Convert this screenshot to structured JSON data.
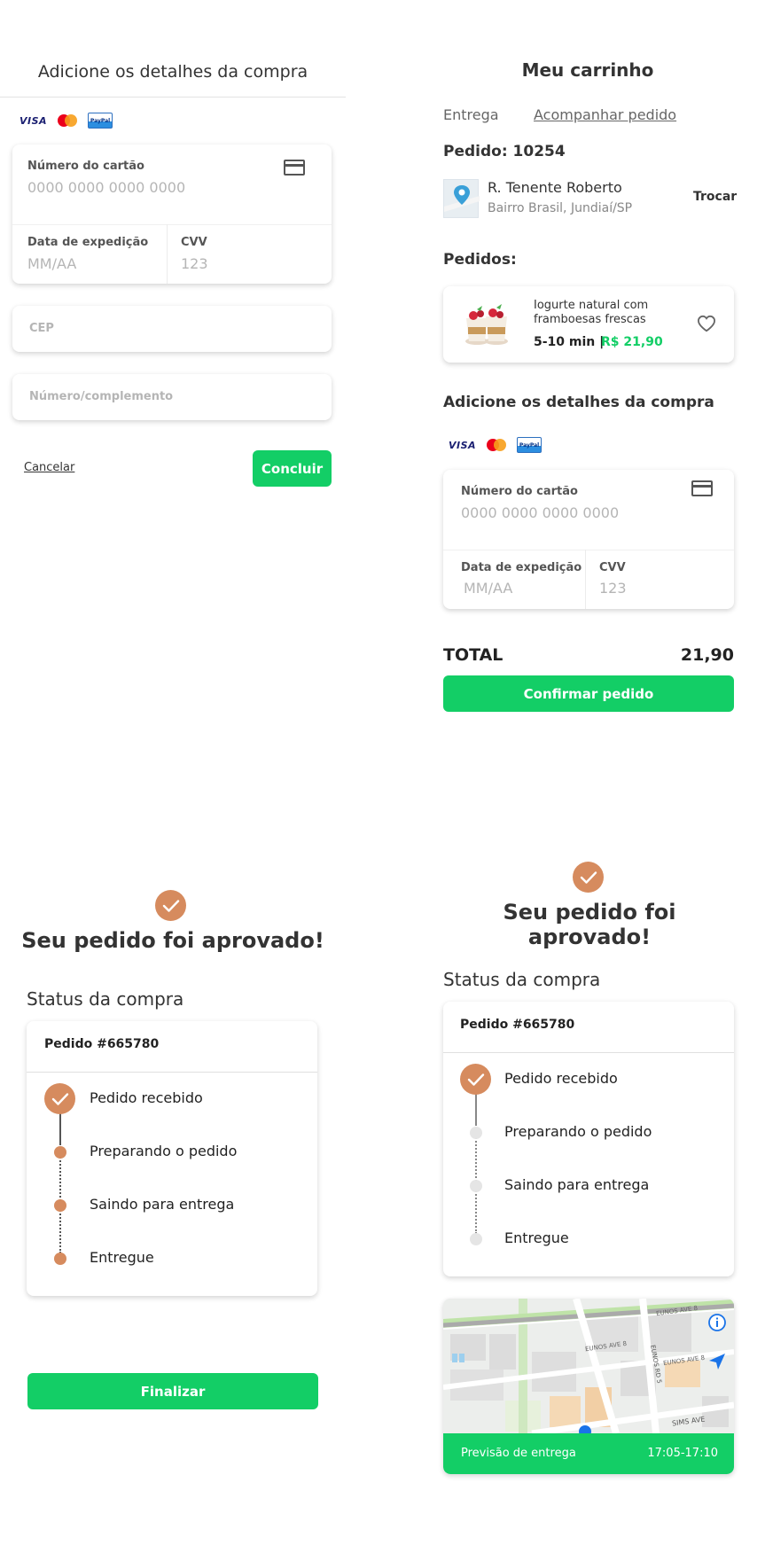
{
  "screen1": {
    "title": "Adicione os detalhes da compra",
    "card_number_label": "Número do cartão",
    "card_number_placeholder": "0000 0000 0000 0000",
    "expiry_label": "Data de expedição",
    "expiry_placeholder": "MM/AA",
    "cvv_label": "CVV",
    "cvv_placeholder": "123",
    "cep_placeholder": "CEP",
    "number_placeholder": "Número/complemento",
    "cancel_label": "Cancelar",
    "conclude_label": "Concluir"
  },
  "screen2": {
    "title": "Meu carrinho",
    "tabs": [
      "Entrega",
      "Acompanhar pedido"
    ],
    "order_label": "Pedido: 10254",
    "address_street": "R. Tenente Roberto",
    "address_district": "Bairro Brasil, Jundiaí/SP",
    "change_label": "Trocar",
    "orders_heading": "Pedidos:",
    "item_name_line1": "Iogurte natural com",
    "item_name_line2": "framboesas frescas",
    "item_time": "5-10 min |",
    "item_price": "R$ 21,90",
    "details_title": "Adicione os detalhes da compra",
    "card_number_label": "Número do cartão",
    "card_number_placeholder": "0000 0000 0000 0000",
    "expiry_label": "Data de expedição",
    "expiry_placeholder": "MM/AA",
    "cvv_label": "CVV",
    "cvv_placeholder": "123",
    "total_label": "TOTAL",
    "total_value": "21,90",
    "confirm_label": "Confirmar pedido"
  },
  "screen3": {
    "approved_title": "Seu pedido foi aprovado!",
    "status_heading": "Status da compra",
    "order_id": "Pedido #665780",
    "steps": [
      "Pedido recebido",
      "Preparando o pedido",
      "Saindo para entrega",
      "Entregue"
    ],
    "finish_label": "Finalizar"
  },
  "screen4": {
    "approved_title": "Seu pedido foi aprovado!",
    "status_heading": "Status da compra",
    "order_id": "Pedido #665780",
    "steps": [
      "Pedido recebido",
      "Preparando o pedido",
      "Saindo para entrega",
      "Entregue"
    ],
    "map_labels": [
      "EUNOS AVE 8",
      "EUNOS AVE 8",
      "EUNOS RD 5",
      "EUNOS AVE 8",
      "SIMS AVE"
    ],
    "delivery_label": "Previsão de entrega",
    "delivery_time": "17:05-17:10"
  },
  "colors": {
    "accent_green": "#13ce66",
    "accent_orange": "#d68b5e",
    "step_inactive": "#e5e5e5"
  }
}
